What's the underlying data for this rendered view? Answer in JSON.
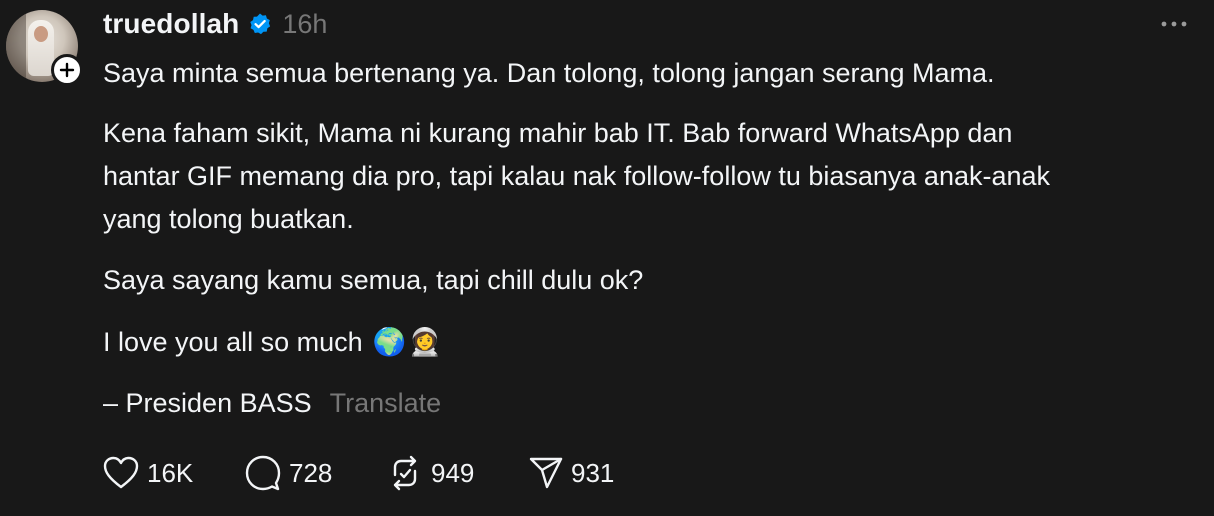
{
  "post": {
    "username": "truedollah",
    "time": "16h",
    "lines": [
      "Saya minta semua bertenang ya. Dan tolong, tolong jangan serang Mama.",
      "Kena faham sikit, Mama ni kurang mahir bab IT. Bab forward WhatsApp dan",
      "hantar GIF memang dia pro, tapi kalau nak follow-follow tu biasanya anak-anak",
      "yang tolong buatkan.",
      "Saya sayang kamu semua, tapi chill dulu ok?",
      "I love you all so much",
      "– Presiden BASS"
    ],
    "emojis": [
      "🌍",
      "👩‍🚀"
    ],
    "translate_label": "Translate"
  },
  "actions": {
    "likes": "16K",
    "replies": "728",
    "reposts": "949",
    "shares": "931"
  },
  "colors": {
    "background": "#181818",
    "text": "#f3f5f7",
    "muted": "#777777",
    "verified": "#0095f6"
  },
  "icons": [
    "follow-plus-icon",
    "verified-badge-icon",
    "more-icon",
    "heart-icon",
    "comment-icon",
    "repost-icon",
    "share-icon"
  ]
}
